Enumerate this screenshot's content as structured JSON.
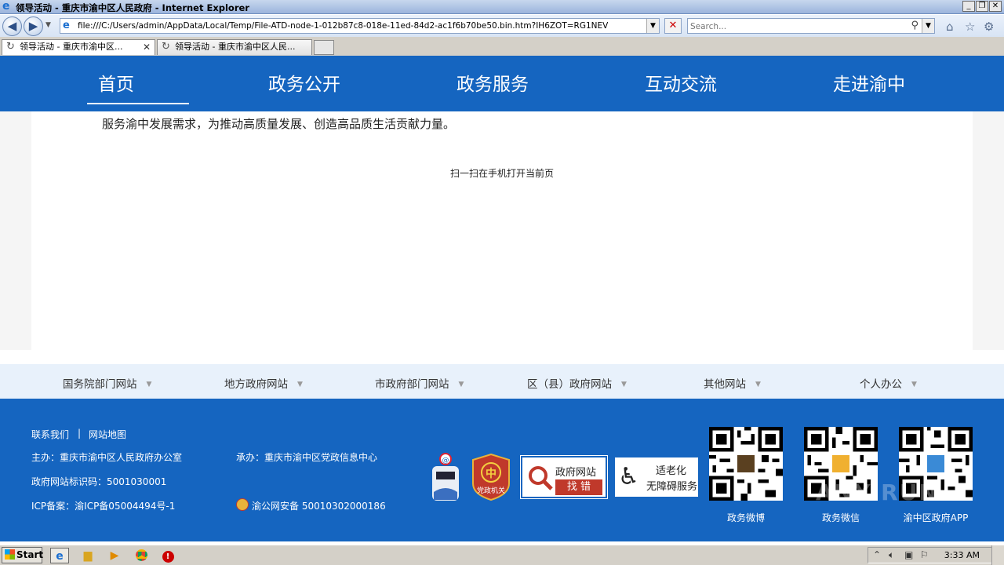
{
  "window": {
    "title": "领导活动 - 重庆市渝中区人民政府 - Internet Explorer",
    "controls": [
      "_",
      "❐",
      "✕"
    ]
  },
  "addressbar": {
    "url": "file:///C:/Users/admin/AppData/Local/Temp/File-ATD-node-1-012b87c8-018e-11ed-84d2-ac1f6b70be50.bin.htm?IH6ZOT=RG1NEV",
    "search_placeholder": "Search..."
  },
  "tabs": [
    {
      "label": "领导活动 - 重庆市渝中区..."
    },
    {
      "label": "领导活动 - 重庆市渝中区人民..."
    }
  ],
  "site_nav": [
    {
      "label": "首页"
    },
    {
      "label": "政务公开"
    },
    {
      "label": "政务服务"
    },
    {
      "label": "互动交流"
    },
    {
      "label": "走进渝中"
    }
  ],
  "content": {
    "paragraph": "服务渝中发展需求，为推动高质量发展、创造高品质生活贡献力量。",
    "scan_text": "扫一扫在手机打开当前页"
  },
  "links_bar": [
    {
      "label": "国务院部门网站"
    },
    {
      "label": "地方政府网站"
    },
    {
      "label": "市政府部门网站"
    },
    {
      "label": "区（县）政府网站"
    },
    {
      "label": "其他网站"
    },
    {
      "label": "个人办公"
    }
  ],
  "footer": {
    "contact": "联系我们",
    "separator": "|",
    "sitemap": "网站地图",
    "host": "主办：重庆市渝中区人民政府办公室",
    "undertake": "承办：重庆市渝中区党政信息中心",
    "site_id": "政府网站标识码：5001030001",
    "icp": "ICP备案：渝ICP备05004494号-1",
    "police": "渝公网安备 50010302000186",
    "badge_party": "党政机关",
    "badge_error_line1": "政府网站",
    "badge_error_line2": "找 错",
    "badge_access_line1": "适老化",
    "badge_access_line2": "无障碍服务",
    "qr_labels": [
      "政务微博",
      "政务微信",
      "渝中区政府APP"
    ]
  },
  "taskbar": {
    "start": "Start",
    "clock": "3:33 AM"
  },
  "watermark": "ANY RUN",
  "colors": {
    "nav_blue": "#1565c0",
    "links_bg": "#e8f1fb",
    "party_red": "#c0392b"
  }
}
